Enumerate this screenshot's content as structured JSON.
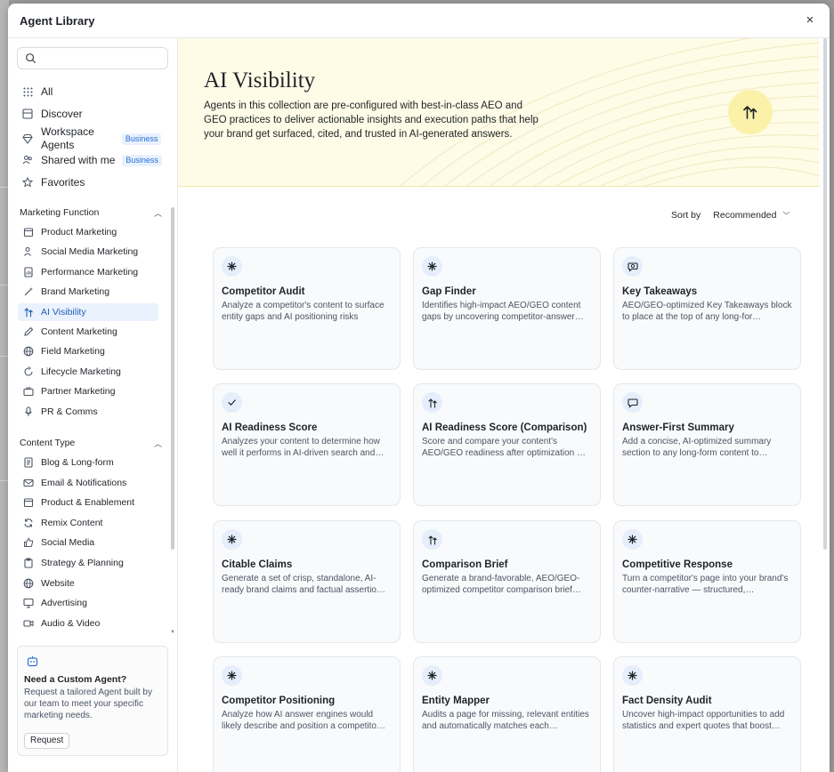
{
  "modal": {
    "title": "Agent Library",
    "close_label": "×"
  },
  "search": {
    "placeholder": "",
    "value": ""
  },
  "nav": {
    "all": "All",
    "discover": "Discover",
    "workspace_line1": "Workspace",
    "workspace_line2": "Agents",
    "workspace_badge": "Business",
    "shared": "Shared with me",
    "shared_badge": "Business",
    "favorites": "Favorites"
  },
  "marketing_function": {
    "title": "Marketing Function",
    "items": [
      {
        "label": "Product Marketing",
        "icon": "box-icon"
      },
      {
        "label": "Social Media Marketing",
        "icon": "users-icon"
      },
      {
        "label": "Performance Marketing",
        "icon": "chart-doc-icon"
      },
      {
        "label": "Brand Marketing",
        "icon": "wand-icon"
      },
      {
        "label": "AI Visibility",
        "icon": "arrows-up-icon"
      },
      {
        "label": "Content Marketing",
        "icon": "pen-icon"
      },
      {
        "label": "Field Marketing",
        "icon": "globe-icon"
      },
      {
        "label": "Lifecycle Marketing",
        "icon": "cycle-icon"
      },
      {
        "label": "Partner Marketing",
        "icon": "briefcase-icon"
      },
      {
        "label": "PR & Comms",
        "icon": "mic-icon"
      }
    ],
    "active_index": 4
  },
  "content_type": {
    "title": "Content Type",
    "items": [
      {
        "label": "Blog & Long-form",
        "icon": "doc-icon"
      },
      {
        "label": "Email & Notifications",
        "icon": "mail-icon"
      },
      {
        "label": "Product & Enablement",
        "icon": "box-icon"
      },
      {
        "label": "Remix Content",
        "icon": "refresh-icon"
      },
      {
        "label": "Social Media",
        "icon": "thumb-icon"
      },
      {
        "label": "Strategy & Planning",
        "icon": "clipboard-icon"
      },
      {
        "label": "Website",
        "icon": "globe-icon"
      },
      {
        "label": "Advertising",
        "icon": "monitor-icon"
      },
      {
        "label": "Audio & Video",
        "icon": "video-icon"
      }
    ]
  },
  "custom_agent": {
    "title": "Need a Custom Agent?",
    "description": "Request a tailored Agent built by our team to meet your specific marketing needs.",
    "button": "Request"
  },
  "hero": {
    "title": "AI Visibility",
    "description": "Agents in this collection are pre-configured with best-in-class AEO and GEO practices to deliver actionable insights and execution paths that help your brand get surfaced, cited, and trusted in AI-generated answers."
  },
  "sort": {
    "label": "Sort by",
    "value": "Recommended"
  },
  "cards": [
    {
      "title": "Competitor Audit",
      "desc": "Analyze a competitor's content to surface entity gaps and AI positioning risks",
      "icon": "sparkle-icon"
    },
    {
      "title": "Gap Finder",
      "desc": "Identifies high-impact AEO/GEO content gaps by uncovering competitor-answer…",
      "icon": "sparkle-icon"
    },
    {
      "title": "Key Takeaways",
      "desc": "AEO/GEO-optimized Key Takeaways block to place at the top of any long-for…",
      "icon": "chat-refresh-icon"
    },
    {
      "title": "AI Readiness Score",
      "desc": "Analyzes your content to determine how well it performs in AI-driven search and…",
      "icon": "check-icon"
    },
    {
      "title": "AI Readiness Score (Comparison)",
      "desc": "Score and compare your content's AEO/GEO readiness after optimization …",
      "icon": "arrows-up-icon"
    },
    {
      "title": "Answer-First Summary",
      "desc": "Add a concise, AI-optimized summary section to any long-form content to…",
      "icon": "chat-icon"
    },
    {
      "title": "Citable Claims",
      "desc": "Generate a set of crisp, standalone, AI-ready brand claims and factual assertio…",
      "icon": "sparkle-icon"
    },
    {
      "title": "Comparison Brief",
      "desc": "Generate a brand-favorable, AEO/GEO-optimized competitor comparison brief…",
      "icon": "arrows-up-icon"
    },
    {
      "title": "Competitive Response",
      "desc": "Turn a competitor's page into your brand's counter-narrative — structured,…",
      "icon": "sparkle-icon"
    },
    {
      "title": "Competitor Positioning",
      "desc": "Analyze how AI answer engines would likely describe and position a competito…",
      "icon": "sparkle-icon"
    },
    {
      "title": "Entity Mapper",
      "desc": "Audits a page for missing, relevant entities and automatically matches each…",
      "icon": "sparkle-icon"
    },
    {
      "title": "Fact Density Audit",
      "desc": "Uncover high-impact opportunities to add statistics and expert quotes that boost…",
      "icon": "sparkle-icon"
    }
  ],
  "colors": {
    "accent": "#1f5fb8",
    "hero_bg": "#fefbe6",
    "badge_bg": "#e8f1fd"
  }
}
